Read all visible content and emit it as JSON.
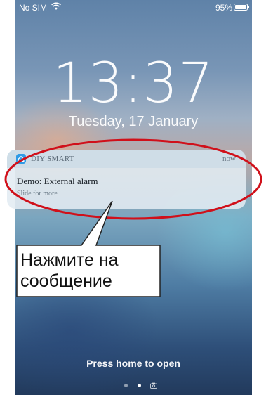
{
  "status_bar": {
    "carrier": "No SIM",
    "battery_percent": "95%"
  },
  "lock_screen": {
    "time": "13:37",
    "date": "Tuesday, 17 January",
    "home_hint": "Press home to open",
    "page_dots": {
      "count": 2,
      "active_index": 1
    }
  },
  "notification": {
    "app_name": "DIY SMART",
    "time": "now",
    "title": "Demo: External alarm",
    "subtitle": "Slide for more"
  },
  "annotation": {
    "line1": "Нажмите на",
    "line2": "сообщение",
    "highlight_color": "#d0101a"
  },
  "icons": {
    "wifi": "wifi-icon",
    "battery": "battery-icon",
    "app": "home-app-icon",
    "camera": "camera-icon"
  }
}
